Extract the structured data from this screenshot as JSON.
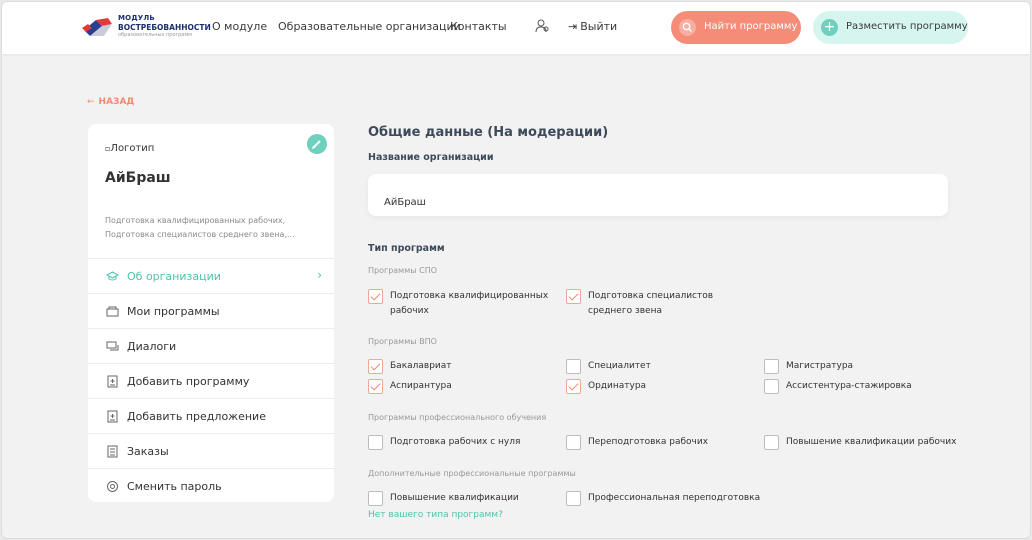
{
  "header": {
    "logo": {
      "line1": "МОДУЛЬ",
      "line2": "ВОСТРЕБОВАННОСТИ",
      "line3": "образовательных программ"
    },
    "nav": [
      "О модуле",
      "Образовательные организации",
      "Контакты"
    ],
    "logout_label": "Выйти",
    "find_button": "Найти программу",
    "post_button": "Разместить программу"
  },
  "back_label": "НАЗАД",
  "sidebar": {
    "logo_alt": "Логотип",
    "org_name": "АйБраш",
    "description_line1": "Подготовка квалифицированных рабочих,",
    "description_line2": "Подготовка специалистов среднего звена,...",
    "menu": [
      {
        "label": "Об организации",
        "icon": "graduation-cap-icon",
        "active": true
      },
      {
        "label": "Мои программы",
        "icon": "programs-icon",
        "active": false
      },
      {
        "label": "Диалоги",
        "icon": "chat-icon",
        "active": false
      },
      {
        "label": "Добавить программу",
        "icon": "add-document-icon",
        "active": false
      },
      {
        "label": "Добавить предложение",
        "icon": "add-document-icon",
        "active": false
      },
      {
        "label": "Заказы",
        "icon": "orders-icon",
        "active": false
      },
      {
        "label": "Сменить пароль",
        "icon": "lock-icon",
        "active": false
      }
    ]
  },
  "main": {
    "title": "Общие данные (На модерации)",
    "org_name_label": "Название организации",
    "org_name_value": "АйБраш",
    "program_type_label": "Тип программ",
    "groups": [
      {
        "label": "Программы СПО",
        "items": [
          {
            "label": "Подготовка квалифицированных рабочих",
            "checked": true
          },
          {
            "label": "Подготовка специалистов среднего звена",
            "checked": true
          }
        ]
      },
      {
        "label": "Программы ВПО",
        "items": [
          {
            "label": "Бакалавриат",
            "checked": true
          },
          {
            "label": "Специалитет",
            "checked": false
          },
          {
            "label": "Магистратура",
            "checked": false
          },
          {
            "label": "Аспирантура",
            "checked": true
          },
          {
            "label": "Ординатура",
            "checked": true
          },
          {
            "label": "Ассистентура-стажировка",
            "checked": false
          }
        ]
      },
      {
        "label": "Программы профессионального обучения",
        "items": [
          {
            "label": "Подготовка рабочих с нуля",
            "checked": false
          },
          {
            "label": "Переподготовка рабочих",
            "checked": false
          },
          {
            "label": "Повышение квалификации рабочих",
            "checked": false
          }
        ]
      },
      {
        "label": "Дополнительные профессиональные программы",
        "items": [
          {
            "label": "Повышение квалификации",
            "checked": false
          },
          {
            "label": "Профессиональная переподготовка",
            "checked": false
          }
        ]
      }
    ],
    "no_type_link": "Нет вашего типа программ?"
  },
  "colors": {
    "accent_coral": "#f58c78",
    "accent_teal": "#6fd0bd",
    "active_teal": "#4fc3ab"
  }
}
